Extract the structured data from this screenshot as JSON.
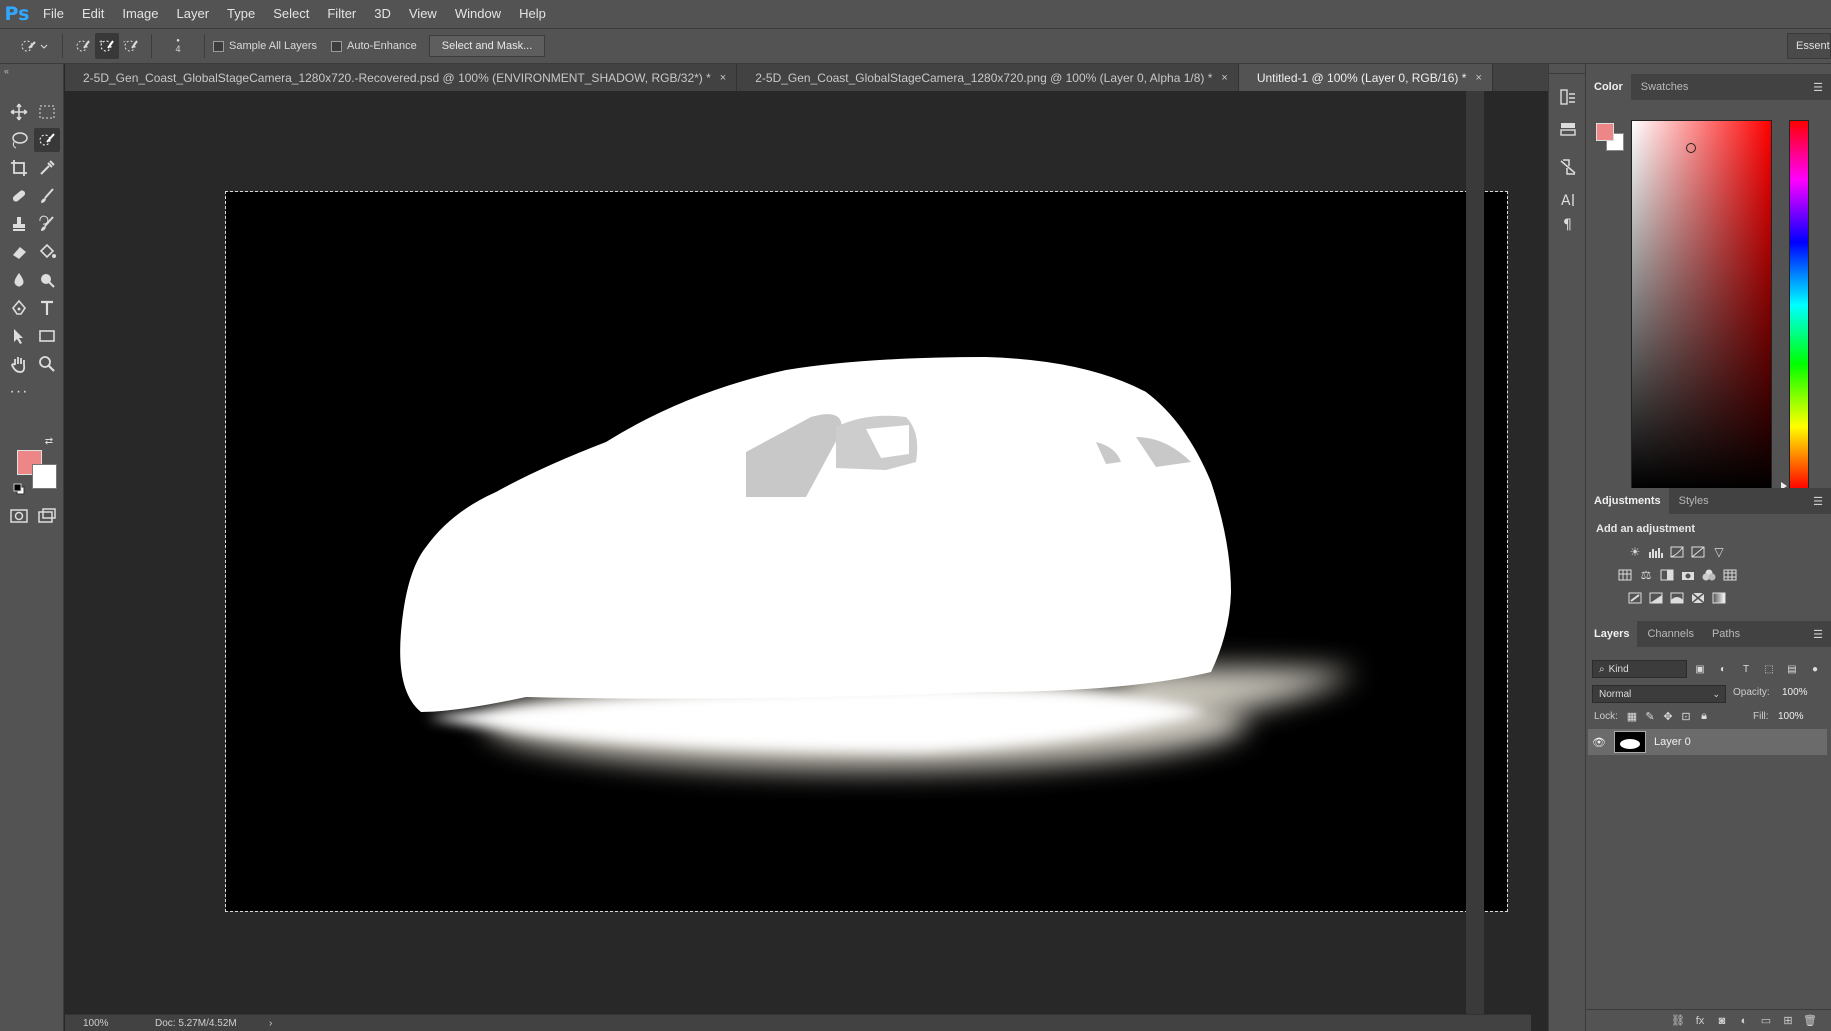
{
  "app": {
    "logo": "Ps"
  },
  "menu": [
    "File",
    "Edit",
    "Image",
    "Layer",
    "Type",
    "Select",
    "Filter",
    "3D",
    "View",
    "Window",
    "Help"
  ],
  "options": {
    "brush_size": "4",
    "sample_all_layers": "Sample All Layers",
    "auto_enhance": "Auto-Enhance",
    "select_and_mask": "Select and Mask...",
    "workspace": "Essentials"
  },
  "tabs": [
    {
      "label": "2-5D_Gen_Coast_GlobalStageCamera_1280x720.-Recovered.psd @ 100% (ENVIRONMENT_SHADOW, RGB/32*) *",
      "active": false
    },
    {
      "label": "2-5D_Gen_Coast_GlobalStageCamera_1280x720.png @ 100% (Layer 0, Alpha 1/8) *",
      "active": false
    },
    {
      "label": "Untitled-1 @ 100% (Layer 0, RGB/16) *",
      "active": true
    }
  ],
  "tab_close": "×",
  "status": {
    "zoom": "100%",
    "doc": "Doc: 5.27M/4.52M",
    "arrow": "›"
  },
  "colors": {
    "foreground": "#ed8686",
    "background": "#ffffff"
  },
  "color_panel": {
    "tabs": [
      "Color",
      "Swatches"
    ],
    "active": "Color"
  },
  "adjustments_panel": {
    "tabs": [
      "Adjustments",
      "Styles"
    ],
    "active": "Adjustments",
    "add_label": "Add an adjustment"
  },
  "layers_panel": {
    "tabs": [
      "Layers",
      "Channels",
      "Paths"
    ],
    "active": "Layers",
    "kind": "Kind",
    "blend_mode": "Normal",
    "opacity_label": "Opacity:",
    "opacity": "100%",
    "lock_label": "Lock:",
    "fill_label": "Fill:",
    "fill": "100%",
    "layers": [
      {
        "name": "Layer 0",
        "visible": true,
        "selected": true
      }
    ]
  },
  "canvas": {
    "content": "white car silhouette mask with soft shadow on black background"
  }
}
